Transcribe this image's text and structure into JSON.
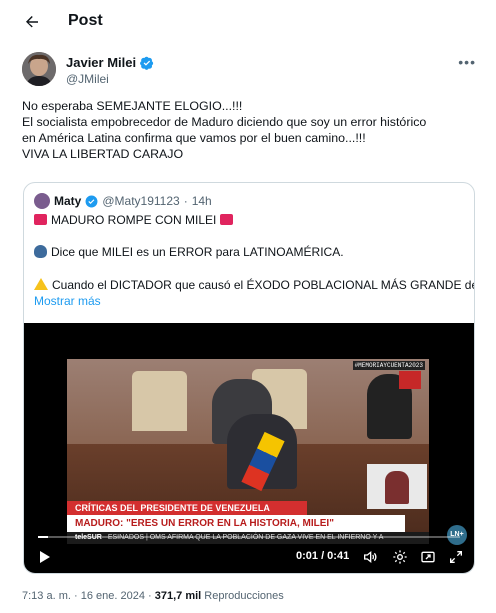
{
  "header": {
    "title": "Post",
    "back_icon": "arrow-left-icon"
  },
  "author": {
    "name": "Javier Milei",
    "handle": "@JMilei",
    "verified_color": "#1d9bf0"
  },
  "post": {
    "lines": [
      "No esperaba SEMEJANTE ELOGIO...!!!",
      "El socialista empobrecedor de Maduro diciendo que soy un error histórico",
      "en América Latina confirma que vamos por el buen camino...!!!",
      "VIVA LA LIBERTAD CARAJO"
    ]
  },
  "quote": {
    "name": "Maty",
    "handle": "@Maty191123",
    "separator": "·",
    "time": "14h",
    "line1": "MADURO ROMPE CON MILEI",
    "line2": "Dice que MILEI es un ERROR para LATINOAMÉRICA.",
    "line3": "Cuando el DICTADOR que causó el ÉXODO POBLACIONAL MÁS GRANDE de...",
    "show_more": "Mostrar más"
  },
  "video": {
    "chyron_top": "CRÍTICAS DEL PRESIDENTE DE VENEZUELA",
    "chyron_main": "MADURO: \"ERES UN ERROR EN LA HISTORIA, MILEI\"",
    "ticker_brand": "teleSUR",
    "ticker_text": "ESINADOS | OMS AFIRMA QUE LA POBLACIÓN DE GAZA VIVE EN EL INFIERNO Y A",
    "badge": "LN+",
    "tag": "#MEMORIAYCUENTA2023",
    "time": "0:01 / 0:41",
    "progress": 0.024
  },
  "meta": {
    "time": "7:13 a. m.",
    "date": "16 ene. 2024",
    "views": "371,7 mil",
    "views_label": "Reproducciones",
    "dot": "·"
  }
}
